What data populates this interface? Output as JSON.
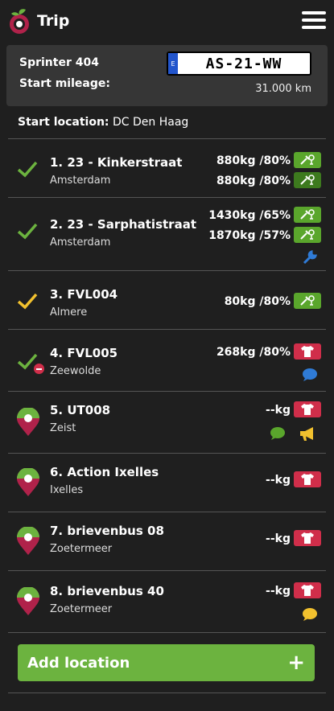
{
  "header": {
    "title": "Trip"
  },
  "vehicle": {
    "name": "Sprinter 404",
    "plate": "AS-21-WW",
    "plate_eu": "E",
    "start_mileage_label": "Start mileage:",
    "start_mileage_value": "31.000 km"
  },
  "start_location": {
    "label": "Start location:",
    "value": "DC Den Haag"
  },
  "stops": [
    {
      "name": "1. 23 - Kinkerstraat",
      "city": "Amsterdam",
      "loads": [
        "880kg /80%",
        "880kg /80%"
      ]
    },
    {
      "name": "2. 23 - Sarphatistraat",
      "city": "Amsterdam",
      "loads": [
        "1430kg /65%",
        "1870kg /57%"
      ]
    },
    {
      "name": "3. FVL004",
      "city": "Almere",
      "loads": [
        "80kg /80%"
      ]
    },
    {
      "name": "4. FVL005",
      "city": "Zeewolde",
      "loads": [
        "268kg /80%"
      ]
    },
    {
      "name": "5. UT008",
      "city": "Zeist",
      "loads": [
        "--kg"
      ]
    },
    {
      "name": "6. Action Ixelles",
      "city": "Ixelles",
      "loads": [
        "--kg"
      ]
    },
    {
      "name": "7. brievenbus 08",
      "city": "Zoetermeer",
      "loads": [
        "--kg"
      ]
    },
    {
      "name": "8. brievenbus 40",
      "city": "Zoetermeer",
      "loads": [
        "--kg"
      ]
    }
  ],
  "add_location": {
    "label": "Add location",
    "plus": "+"
  },
  "colors": {
    "green": "#5aa62c",
    "red": "#d02e4a",
    "yellow": "#f2c12e",
    "blue": "#2f7bd6"
  }
}
